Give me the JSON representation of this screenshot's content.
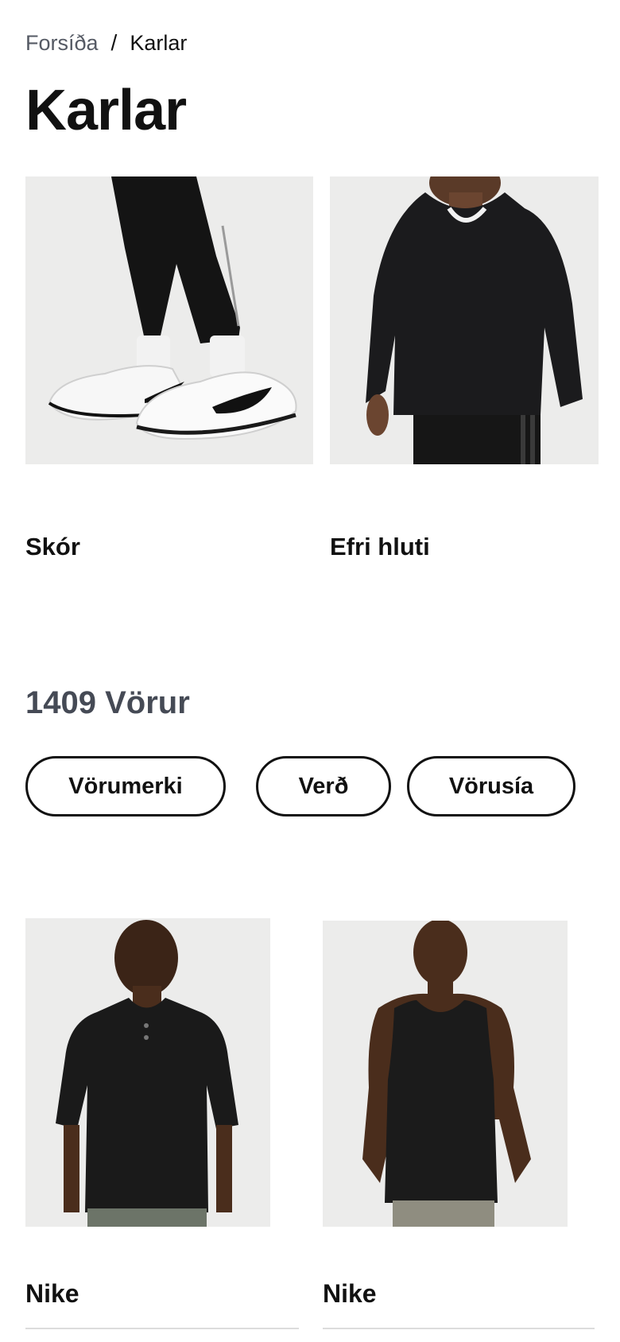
{
  "breadcrumb": {
    "home": "Forsíða",
    "separator": "/",
    "current": "Karlar"
  },
  "page_title": "Karlar",
  "categories": [
    {
      "label": "Skór",
      "image": "shoes-photo"
    },
    {
      "label": "Efri hluti",
      "image": "hoodie-photo"
    }
  ],
  "results": {
    "count_text": "1409 Vörur"
  },
  "filters": [
    {
      "label": "Vörumerki"
    },
    {
      "label": "Verð"
    },
    {
      "label": "Vörusía"
    }
  ],
  "products": [
    {
      "brand": "Nike",
      "image": "polo-shirt-photo"
    },
    {
      "brand": "Nike",
      "image": "tank-top-photo"
    }
  ],
  "colors": {
    "text": "#111111",
    "muted": "#454a55",
    "image_bg": "#ececeb"
  }
}
